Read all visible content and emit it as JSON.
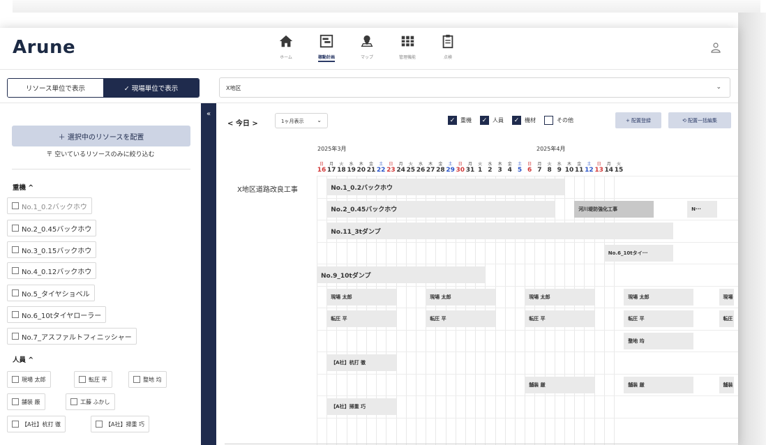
{
  "app": {
    "logo": "Arune"
  },
  "nav": [
    {
      "label": "ホーム",
      "icon": "home-icon",
      "active": false
    },
    {
      "label": "稼動計画",
      "icon": "schedule-board-icon",
      "active": true
    },
    {
      "label": "マップ",
      "icon": "map-pin-icon",
      "active": false
    },
    {
      "label": "管理機能",
      "icon": "grid-icon",
      "active": false
    },
    {
      "label": "点検",
      "icon": "clipboard-icon",
      "active": false
    }
  ],
  "toolbar": {
    "view_resource": "リソース単位で表示",
    "view_site": "✓ 現場単位で表示",
    "site_value": "X地区"
  },
  "sidebar": {
    "collapse_label": "«",
    "place_button": "＋ 選択中のリソースを配置",
    "filter_link": "〒 空いているリソースのみに絞り込む",
    "heavy_header": "重機 ^",
    "heavy": [
      "No.1_0.2バックホウ",
      "No.2_0.45バックホウ",
      "No.3_0.15バックホウ",
      "No.4_0.12バックホウ",
      "No.5_タイヤショベル",
      "No.6_10tタイヤローラー",
      "No.7_アスファルトフィニッシャー"
    ],
    "people_header": "人員 ^",
    "people": [
      "現場 太郎",
      "転圧 平",
      "整地 均",
      "舗装 厳",
      "工藤 ふかし",
      "【A社】杭打 徹",
      "【A社】掃重 巧"
    ]
  },
  "main": {
    "today": "< 今日 >",
    "range": "1ヶ月表示",
    "range_chev": "⌄",
    "filters": [
      {
        "label": "重機",
        "checked": true
      },
      {
        "label": "人員",
        "checked": true
      },
      {
        "label": "機材",
        "checked": true
      },
      {
        "label": "その他",
        "checked": false
      }
    ],
    "add_button": "+ 配置登録",
    "bulk_button": "⟲ 配置一括編集"
  },
  "calendar": {
    "months": [
      "2025年3月",
      "2025年4月"
    ],
    "days": [
      {
        "n": "16",
        "w": "日"
      },
      {
        "n": "17",
        "w": "月"
      },
      {
        "n": "18",
        "w": "火"
      },
      {
        "n": "19",
        "w": "水"
      },
      {
        "n": "20",
        "w": "木"
      },
      {
        "n": "21",
        "w": "金"
      },
      {
        "n": "22",
        "w": "土"
      },
      {
        "n": "23",
        "w": "日"
      },
      {
        "n": "24",
        "w": "月"
      },
      {
        "n": "25",
        "w": "火"
      },
      {
        "n": "26",
        "w": "水"
      },
      {
        "n": "27",
        "w": "木"
      },
      {
        "n": "28",
        "w": "金"
      },
      {
        "n": "29",
        "w": "土"
      },
      {
        "n": "30",
        "w": "日"
      },
      {
        "n": "31",
        "w": "月"
      },
      {
        "n": "1",
        "w": "火"
      },
      {
        "n": "2",
        "w": "水"
      },
      {
        "n": "3",
        "w": "木"
      },
      {
        "n": "4",
        "w": "金"
      },
      {
        "n": "5",
        "w": "土"
      },
      {
        "n": "6",
        "w": "日"
      },
      {
        "n": "7",
        "w": "月"
      },
      {
        "n": "8",
        "w": "火"
      },
      {
        "n": "9",
        "w": "水"
      },
      {
        "n": "10",
        "w": "木"
      },
      {
        "n": "11",
        "w": "金"
      },
      {
        "n": "12",
        "w": "土"
      },
      {
        "n": "13",
        "w": "日"
      },
      {
        "n": "14",
        "w": "月"
      },
      {
        "n": "15",
        "w": "火"
      }
    ],
    "site_name": "X地区道路改良工事",
    "bars": [
      "No.1_0.2バックホウ",
      "No.2_0.45バックホウ",
      "河川堤防強化工事",
      "N···",
      "No.11_3tダンプ",
      "No.6_10tタイ···",
      "No.9_10tダンプ",
      "現場 太郎",
      "現場 太郎",
      "現場 太郎",
      "現場 太郎",
      "現場 太",
      "転圧 平",
      "転圧 平",
      "転圧 平",
      "転圧 平",
      "転圧 平",
      "整地 均",
      "【A社】杭打 徹",
      "舗装 厳",
      "舗装 厳",
      "舗装 厳",
      "【A社】掃重 巧"
    ]
  }
}
